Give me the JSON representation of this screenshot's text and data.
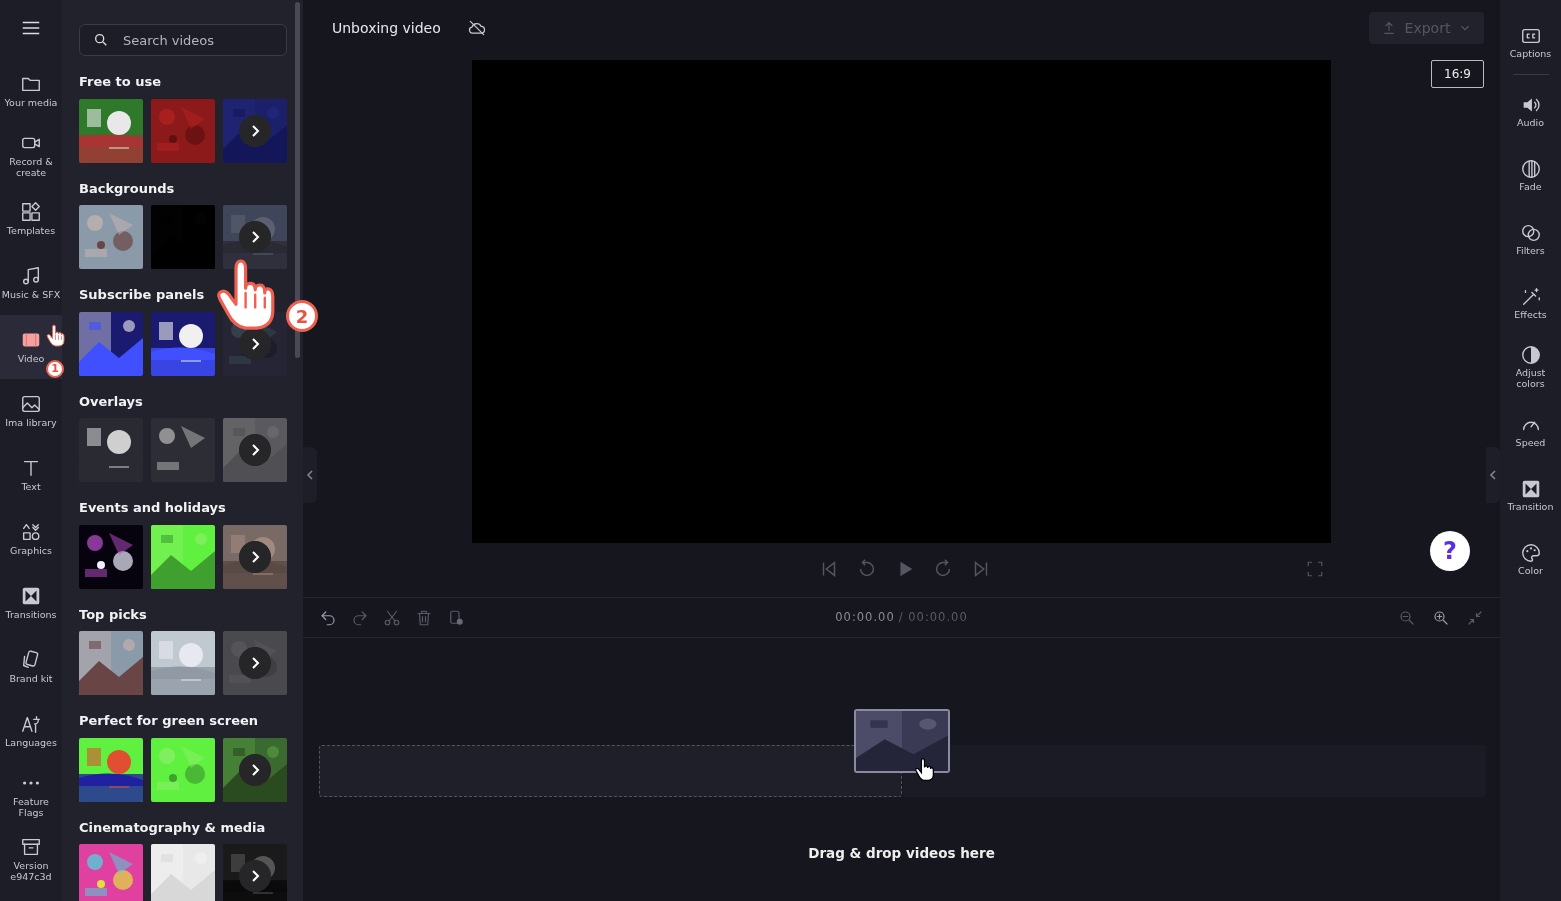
{
  "nav": [
    {
      "label": "Your media",
      "selected": false
    },
    {
      "label": "Record & create",
      "selected": false
    },
    {
      "label": "Templates",
      "selected": false
    },
    {
      "label": "Music & SFX",
      "selected": false
    },
    {
      "label": "Video",
      "selected": true
    },
    {
      "label": "Ima library",
      "selected": false
    },
    {
      "label": "Text",
      "selected": false
    },
    {
      "label": "Graphics",
      "selected": false
    },
    {
      "label": "Transitions",
      "selected": false
    },
    {
      "label": "Brand kit",
      "selected": false
    },
    {
      "label": "Languages",
      "selected": false
    },
    {
      "label": "Feature Flags",
      "selected": false
    },
    {
      "label": "Version e947c3d",
      "selected": false
    }
  ],
  "search": {
    "placeholder": "Search videos"
  },
  "sections": [
    {
      "title": "Free to use",
      "thumbs": [
        {
          "kind": "picture"
        },
        {
          "kind": "picture"
        },
        {
          "kind": "more"
        }
      ]
    },
    {
      "title": "Backgrounds",
      "thumbs": [
        {
          "kind": "picture"
        },
        {
          "kind": "picture"
        },
        {
          "kind": "more"
        }
      ]
    },
    {
      "title": "Subscribe panels",
      "thumbs": [
        {
          "kind": "picture"
        },
        {
          "kind": "picture"
        },
        {
          "kind": "more"
        }
      ]
    },
    {
      "title": "Overlays",
      "thumbs": [
        {
          "kind": "picture"
        },
        {
          "kind": "picture"
        },
        {
          "kind": "more"
        }
      ]
    },
    {
      "title": "Events and holidays",
      "thumbs": [
        {
          "kind": "picture"
        },
        {
          "kind": "picture"
        },
        {
          "kind": "more"
        }
      ]
    },
    {
      "title": "Top picks",
      "thumbs": [
        {
          "kind": "picture"
        },
        {
          "kind": "picture"
        },
        {
          "kind": "more"
        }
      ]
    },
    {
      "title": "Perfect for green screen",
      "thumbs": [
        {
          "kind": "picture"
        },
        {
          "kind": "picture"
        },
        {
          "kind": "more"
        }
      ]
    },
    {
      "title": "Cinematography & media",
      "thumbs": [
        {
          "kind": "picture"
        },
        {
          "kind": "picture"
        },
        {
          "kind": "more"
        }
      ]
    }
  ],
  "project": {
    "title": "Unboxing video",
    "export": "Export",
    "aspect": "16:9"
  },
  "timeline": {
    "current": "00:00.00",
    "total": "/ 00:00.00",
    "drop_hint": "Drag & drop videos here"
  },
  "tools": [
    {
      "label": "Captions"
    },
    {
      "label": "Audio"
    },
    {
      "label": "Fade"
    },
    {
      "label": "Filters"
    },
    {
      "label": "Effects"
    },
    {
      "label": "Adjust colors"
    },
    {
      "label": "Speed"
    },
    {
      "label": "Transition"
    },
    {
      "label": "Color"
    }
  ],
  "help": {
    "label": "?"
  },
  "annotations": [
    {
      "step": "1"
    },
    {
      "step": "2"
    }
  ]
}
